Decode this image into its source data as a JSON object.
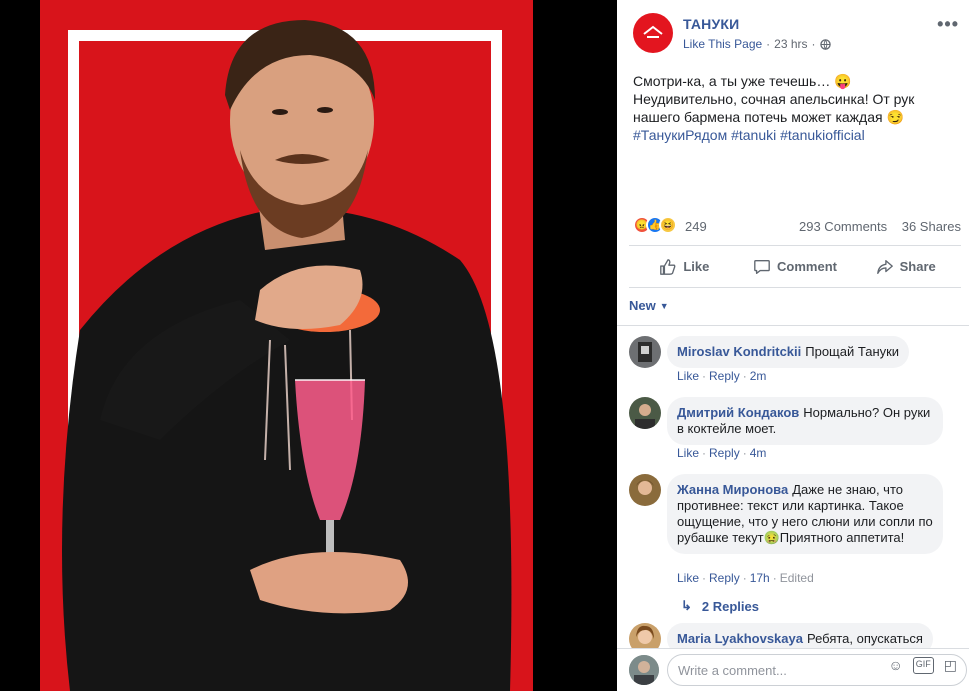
{
  "page": {
    "name": "ТАНУКИ",
    "like_link": "Like This Page",
    "separator": "·",
    "time": "23 hrs",
    "audience_icon": "globe-icon"
  },
  "post": {
    "line1": "Смотри-ка, а ты уже течешь… 😛",
    "line2": "Неудивительно, сочная апельсинка! От рук нашего бармена потечь может каждая 😏",
    "hashtags": "#ТанукиРядом #tanuki #tanukiofficial"
  },
  "stats": {
    "reactions": "249",
    "comments": "293 Comments",
    "shares": "36 Shares"
  },
  "actions": {
    "like": "Like",
    "comment": "Comment",
    "share": "Share"
  },
  "sort": {
    "label": "New"
  },
  "comments": [
    {
      "author": "Miroslav Kondritckii",
      "text": "Прощай Тануки",
      "like": "Like",
      "reply": "Reply",
      "time": "2m"
    },
    {
      "author": "Дмитрий Кондаков",
      "text": "Нормально? Он руки в коктейле моет.",
      "like": "Like",
      "reply": "Reply",
      "time": "4m"
    },
    {
      "author": "Жанна Миронова",
      "text": "Даже не знаю, что противнее: текст или картинка. Такое ощущение, что у него слюни или сопли по рубашке текут🤢Приятного аппетита!",
      "like": "Like",
      "reply": "Reply",
      "time": "17h",
      "edited": "Edited"
    },
    {
      "author": "Maria Lyakhovskaya",
      "text": "Ребята, опускаться"
    }
  ],
  "replies": {
    "label": "2 Replies"
  },
  "composer": {
    "placeholder": "Write a comment..."
  },
  "colors": {
    "brand_red": "#e3151f",
    "link_blue": "#385898"
  }
}
